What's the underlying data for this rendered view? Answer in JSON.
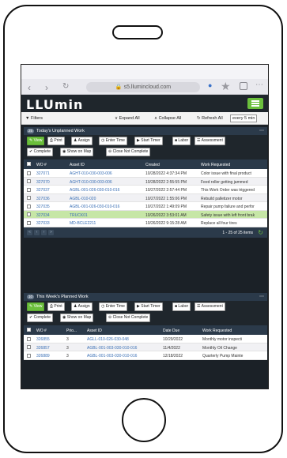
{
  "browser": {
    "url": "s5.llumincloud.com"
  },
  "app": {
    "logo": "LLUmin"
  },
  "toolbar": {
    "filters": "Filters",
    "expand_all": "Expand All",
    "collapse_all": "Collapse All",
    "refresh_all": "Refresh All",
    "refresh_interval": "every 5 min"
  },
  "panel1": {
    "badge": "25",
    "title": "Today's Unplanned Work",
    "buttons": [
      "View",
      "Print",
      "Assign",
      "Enter Time",
      "Start Timer",
      "Labor",
      "Assessment"
    ],
    "buttons2": [
      "Complete",
      "Show on Map",
      "Close Not Complete"
    ],
    "columns": [
      "WO #",
      "Asset ID",
      "Created",
      "Work Requested"
    ],
    "rows": [
      {
        "wo": "327071",
        "asset": "AGHT-010-030-003-006",
        "created": "10/28/2022 4:37:34 PM",
        "work": "Color issue with final product"
      },
      {
        "wo": "327070",
        "asset": "AGHT-010-030-003-006",
        "created": "10/28/2022 2:55:55 PM",
        "work": "Feed roller getting jammed"
      },
      {
        "wo": "327037",
        "asset": "AGBL-001-026-030-010-016",
        "created": "10/27/2022 2:57:44 PM",
        "work": "This Work Order was triggered"
      },
      {
        "wo": "327036",
        "asset": "AGBL-010-020",
        "created": "10/27/2022 1:55:06 PM",
        "work": "Rebuild palletizer motor"
      },
      {
        "wo": "327035",
        "asset": "AGBL-001-026-030-010-016",
        "created": "10/27/2022 1:49:09 PM",
        "work": "Repair pump failure and perfor"
      },
      {
        "wo": "327034",
        "asset": "TRUCK01",
        "created": "10/26/2022 3:53:01 AM",
        "work": "Safety issue with left front brak"
      },
      {
        "wo": "327033",
        "asset": "MD-BCLE2211",
        "created": "10/26/2022 9:15:28 AM",
        "work": "Replace all four tires"
      }
    ],
    "pager_text": "1 - 25 of 25 items"
  },
  "panel2": {
    "badge": "10",
    "title": "This Week's Planned Work",
    "buttons": [
      "View",
      "Print",
      "Assign",
      "Enter Time",
      "Start Timer",
      "Labor",
      "Assessment"
    ],
    "buttons2": [
      "Complete",
      "Show on Map",
      "Close Not Complete"
    ],
    "columns": [
      "WO #",
      "Prio...",
      "Asset ID",
      "Date Due",
      "Work Requested"
    ],
    "rows": [
      {
        "wo": "326855",
        "prio": "3",
        "asset": "AGLL-010-026-030-048",
        "due": "10/29/2022",
        "work": "Monthly motor inspecti"
      },
      {
        "wo": "326857",
        "prio": "3",
        "asset": "AGBL-001-003-030-010-016",
        "due": "11/4/2022",
        "work": "Monthly Oil Change"
      },
      {
        "wo": "326889",
        "prio": "3",
        "asset": "AGBL-001-003-030-010-016",
        "due": "12/18/2022",
        "work": "Quarterly Pump Mainte"
      }
    ]
  },
  "colors": {
    "accent": "#6bbf3c",
    "header": "#2b3a4a",
    "selected": "#c6e6a6"
  }
}
